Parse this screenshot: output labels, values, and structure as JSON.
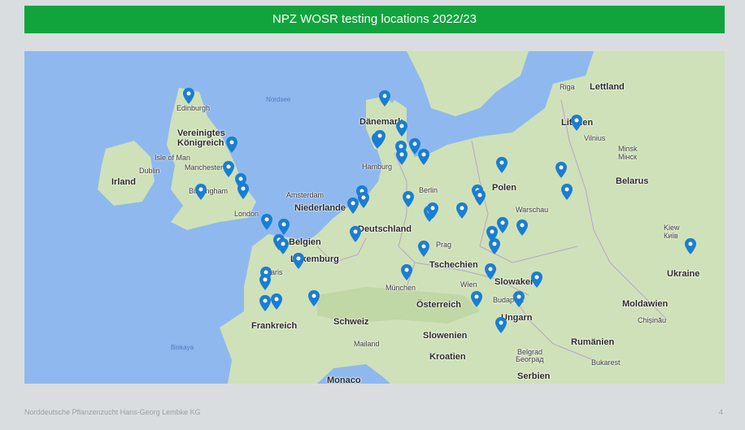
{
  "title": "NPZ WOSR testing locations 2022/23",
  "footer": "Norddeutsche Pflanzenzucht Hans-Georg Lembke KG",
  "page_number": "4",
  "colors": {
    "title_bg": "#11a43d",
    "water": "#8fb8ee",
    "land": "#c9dfb2",
    "marker": "#1a7ed1"
  },
  "map": {
    "labels": [
      {
        "text": "Nordsee",
        "kind": "sea"
      },
      {
        "text": "Edinburgh",
        "kind": "city"
      },
      {
        "text": "Vereinigtes",
        "kind": "country"
      },
      {
        "text": "Königreich",
        "kind": "country"
      },
      {
        "text": "Isle of Man",
        "kind": "city"
      },
      {
        "text": "Dublin",
        "kind": "city"
      },
      {
        "text": "Irland",
        "kind": "country"
      },
      {
        "text": "Manchester",
        "kind": "city"
      },
      {
        "text": "Birmingham",
        "kind": "city"
      },
      {
        "text": "London",
        "kind": "city"
      },
      {
        "text": "Dänemark",
        "kind": "country"
      },
      {
        "text": "Hamburg",
        "kind": "city"
      },
      {
        "text": "Amsterdam",
        "kind": "city"
      },
      {
        "text": "Niederlande",
        "kind": "country"
      },
      {
        "text": "Berlin",
        "kind": "city"
      },
      {
        "text": "Deutschland",
        "kind": "country"
      },
      {
        "text": "Belgien",
        "kind": "country"
      },
      {
        "text": "Luxemburg",
        "kind": "country"
      },
      {
        "text": "Paris",
        "kind": "city"
      },
      {
        "text": "Prag",
        "kind": "city"
      },
      {
        "text": "Tschechien",
        "kind": "country"
      },
      {
        "text": "München",
        "kind": "city"
      },
      {
        "text": "Wien",
        "kind": "city"
      },
      {
        "text": "Österreich",
        "kind": "country"
      },
      {
        "text": "Schweiz",
        "kind": "country"
      },
      {
        "text": "Frankreich",
        "kind": "country"
      },
      {
        "text": "Mailand",
        "kind": "city"
      },
      {
        "text": "Slowenien",
        "kind": "country"
      },
      {
        "text": "Kroatien",
        "kind": "country"
      },
      {
        "text": "Biskaya",
        "kind": "sea"
      },
      {
        "text": "Monaco",
        "kind": "country"
      },
      {
        "text": "Polen",
        "kind": "country"
      },
      {
        "text": "Warschau",
        "kind": "city"
      },
      {
        "text": "Slowakei",
        "kind": "country"
      },
      {
        "text": "Budapest",
        "kind": "city"
      },
      {
        "text": "Ungarn",
        "kind": "country"
      },
      {
        "text": "Belgrad",
        "kind": "city"
      },
      {
        "text": "Београд",
        "kind": "city"
      },
      {
        "text": "Serbien",
        "kind": "country"
      },
      {
        "text": "Rumänien",
        "kind": "country"
      },
      {
        "text": "Bukarest",
        "kind": "city"
      },
      {
        "text": "Moldawien",
        "kind": "country"
      },
      {
        "text": "Chișinău",
        "kind": "city"
      },
      {
        "text": "Ukraine",
        "kind": "country"
      },
      {
        "text": "Kiew",
        "kind": "city"
      },
      {
        "text": "Київ",
        "kind": "city"
      },
      {
        "text": "Belarus",
        "kind": "country"
      },
      {
        "text": "Minsk",
        "kind": "city"
      },
      {
        "text": "Мінск",
        "kind": "city"
      },
      {
        "text": "Vilnius",
        "kind": "city"
      },
      {
        "text": "Litauen",
        "kind": "country"
      },
      {
        "text": "Riga",
        "kind": "city"
      },
      {
        "text": "Lettland",
        "kind": "country"
      }
    ],
    "marker_count": 48
  }
}
